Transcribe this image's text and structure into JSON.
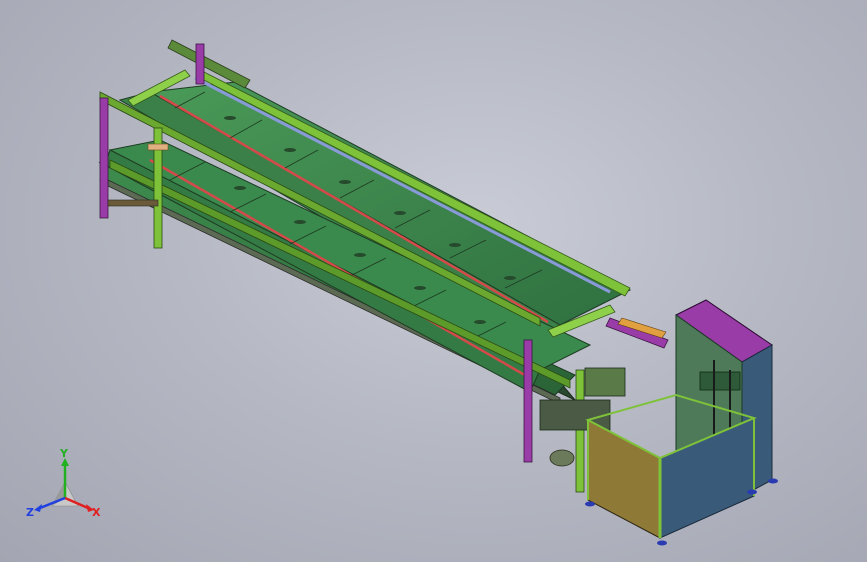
{
  "viewport": {
    "background_color": "#b8bbc6",
    "model_name": "conveyor-assembly"
  },
  "triad": {
    "x_label": "X",
    "y_label": "Y",
    "z_label": "Z",
    "x_color": "#e02020",
    "y_color": "#20b020",
    "z_color": "#2040e0"
  },
  "model_colors": {
    "belt_green": "#3c8a4c",
    "belt_dark": "#2e6c3a",
    "rail_green": "#7ec23a",
    "red_stripe": "#d44a4a",
    "blue_stripe": "#8a9ad8",
    "purple_frame": "#9a3ca8",
    "yellow_panel": "#8e7a36",
    "blue_panel": "#3a5a7a",
    "tan_roller": "#e0b080"
  }
}
